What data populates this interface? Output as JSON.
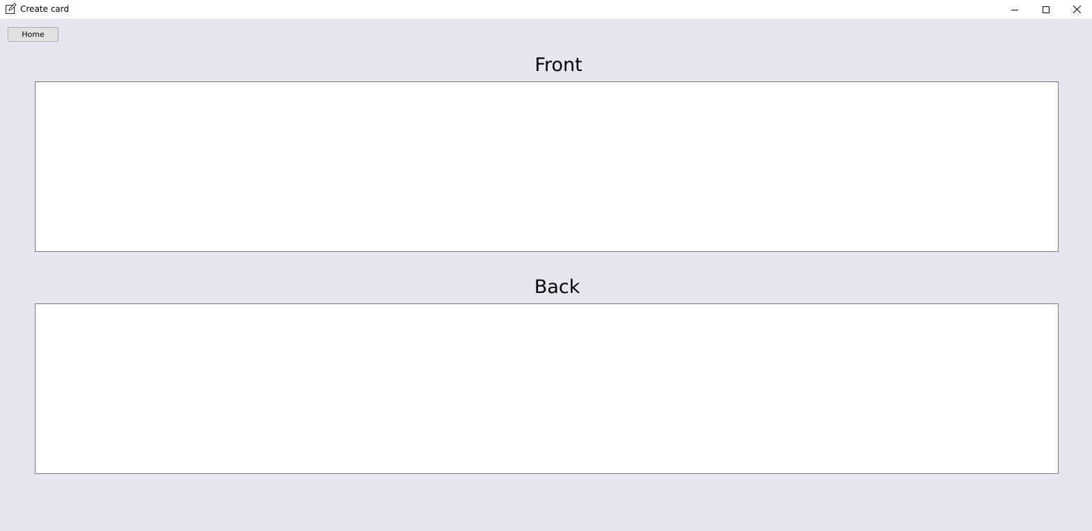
{
  "window": {
    "title": "Create card",
    "icon": "edit-note-icon",
    "controls": [
      "minimize-icon",
      "maximize-icon",
      "close-icon"
    ]
  },
  "toolbar": {
    "home_label": "Home"
  },
  "front": {
    "heading": "Front",
    "value": ""
  },
  "back": {
    "heading": "Back",
    "value": ""
  },
  "colors": {
    "background": "#e6e6f0",
    "field_background": "#ffffff",
    "field_border": "#7a7a7a",
    "button_background": "#e1e1e1"
  }
}
